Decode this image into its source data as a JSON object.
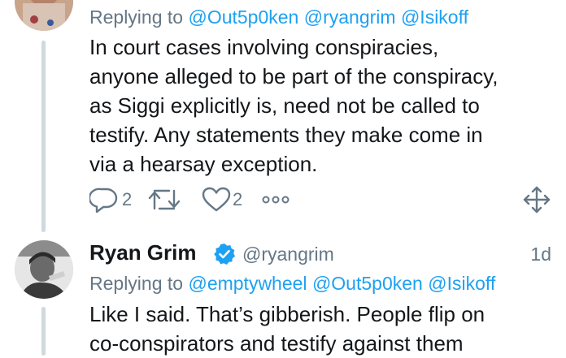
{
  "tweet1": {
    "reply_prefix": "Replying to",
    "mentions": [
      "@Out5p0ken",
      "@ryangrim",
      "@Isikoff"
    ],
    "text_lines": [
      "In court cases involving conspiracies,",
      "anyone alleged to be part of the conspiracy,",
      "as Siggi explicitly is, need not be called to",
      "testify. Any statements they make come in",
      "via a hearsay exception."
    ],
    "reply_count": "2",
    "like_count": "2"
  },
  "tweet2": {
    "author_name": "Ryan Grim",
    "handle": "@ryangrim",
    "timestamp": "1d",
    "reply_prefix": "Replying to",
    "mentions": [
      "@emptywheel",
      "@Out5p0ken",
      "@Isikoff"
    ],
    "text_lines": [
      "Like I said. That’s gibberish. People flip on",
      "co-conspirators and testify against them"
    ]
  },
  "icons": {
    "reply": "reply-icon",
    "retweet": "retweet-icon",
    "like": "heart-icon",
    "more": "more-icon",
    "move": "move-icon",
    "verified": "verified-badge-icon"
  },
  "colors": {
    "accent": "#1da1f2",
    "secondary_text": "#657786",
    "primary_text": "#14171a",
    "thread_line": "#cfd9de"
  }
}
